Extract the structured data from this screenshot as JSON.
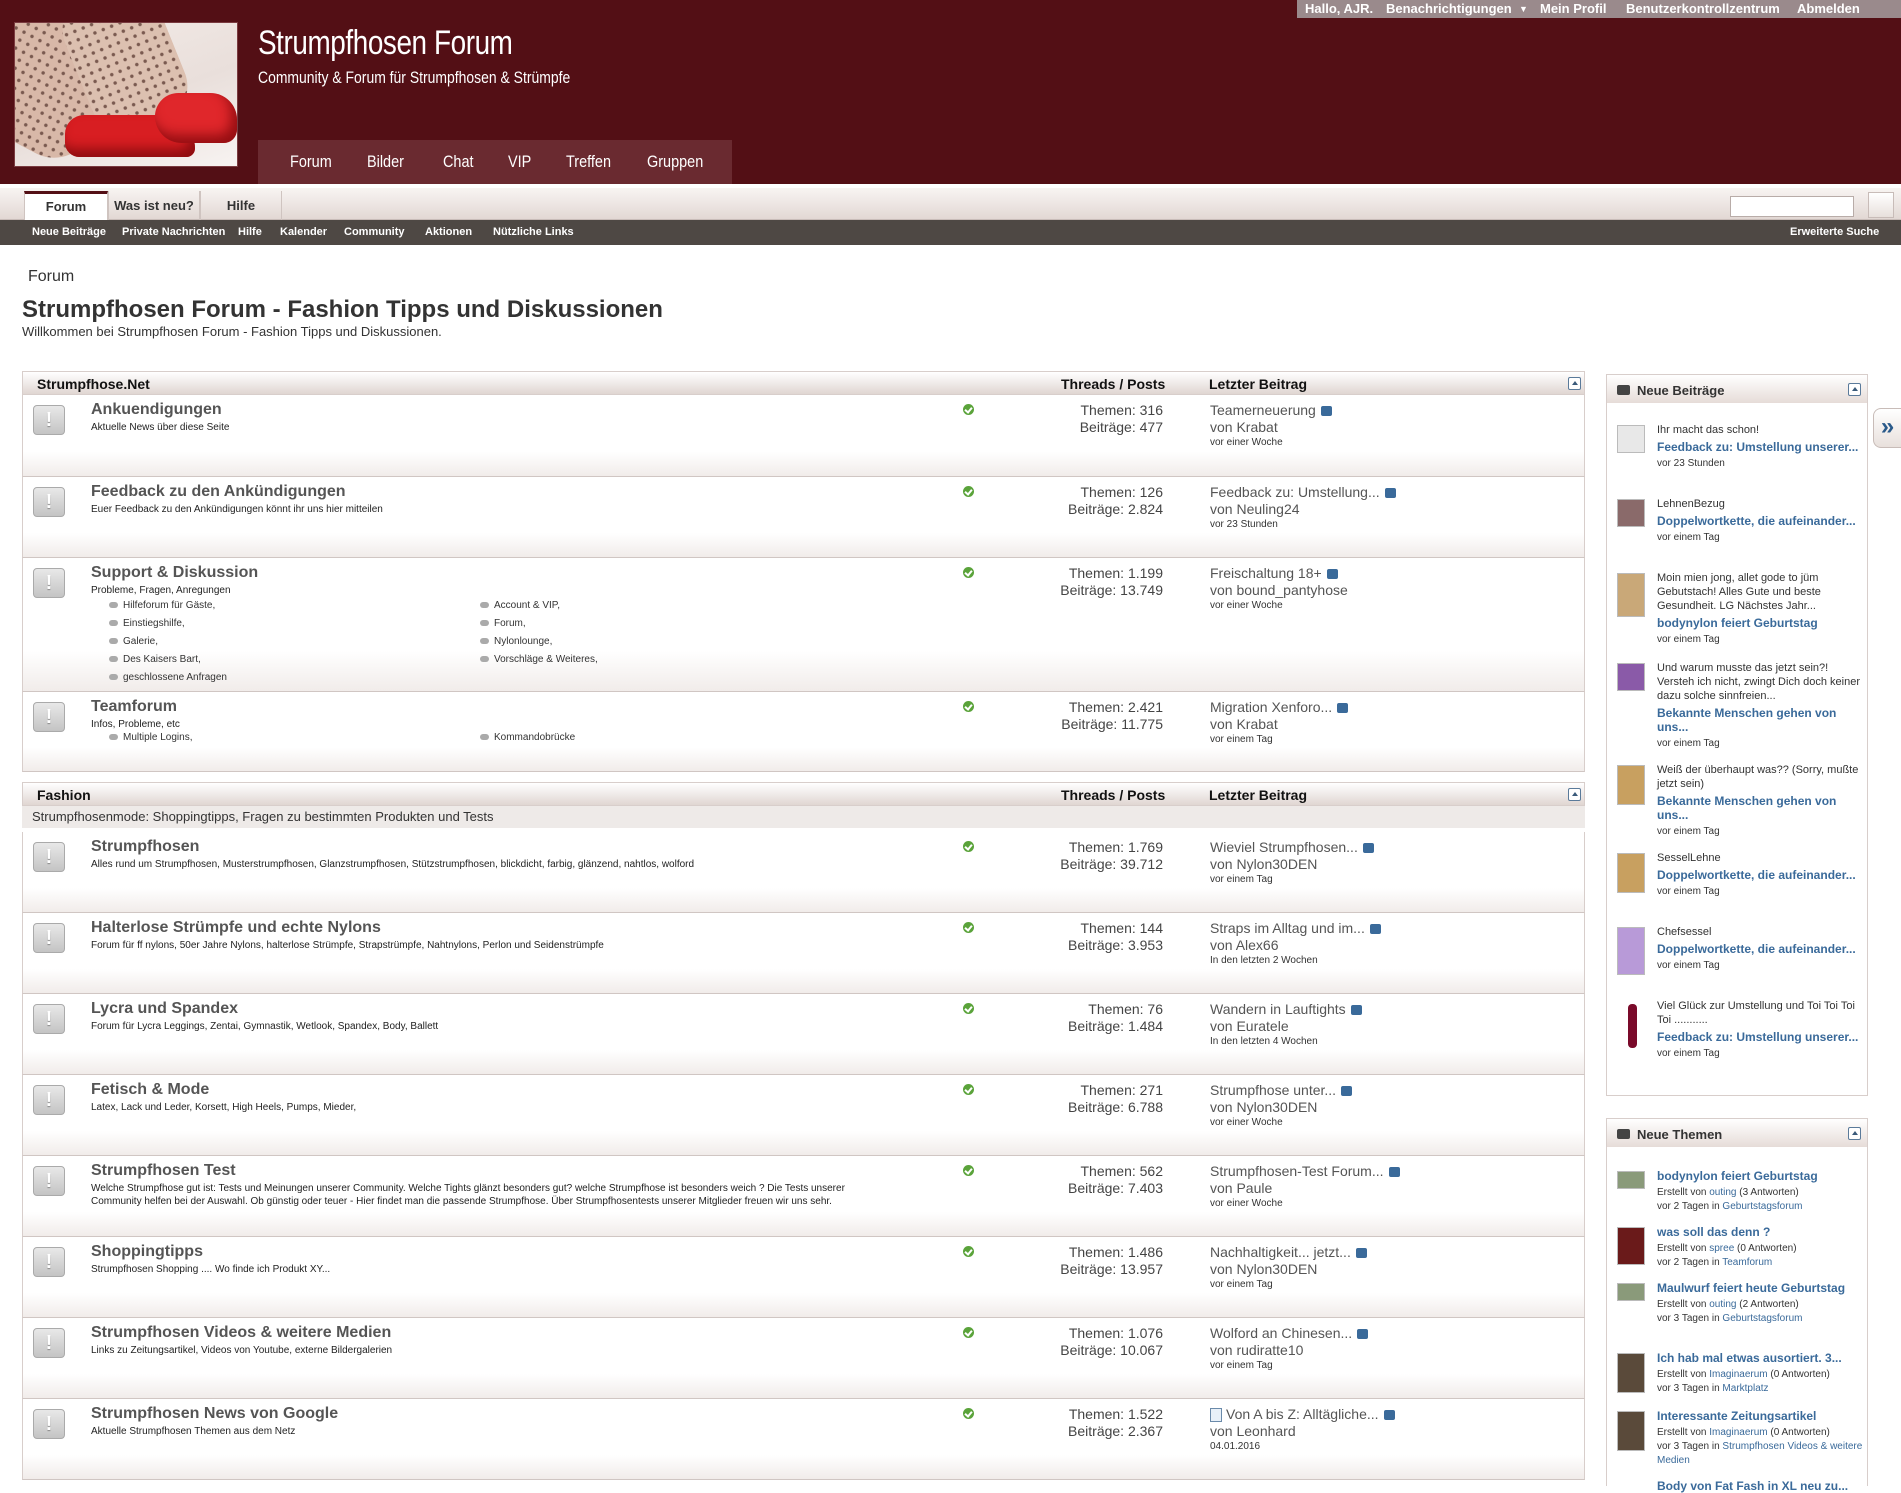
{
  "site": {
    "title": "Strumpfhosen Forum",
    "subtitle": "Community & Forum für Strumpfhosen & Strümpfe"
  },
  "topnav": [
    "Forum",
    "Bilder",
    "Chat",
    "VIP",
    "Treffen",
    "Gruppen"
  ],
  "visitor": {
    "greeting": "Hallo, AJR.",
    "notifications": "Benachrichtigungen",
    "profile": "Mein Profil",
    "cp": "Benutzerkontrollzentrum",
    "logout": "Abmelden"
  },
  "tabs": [
    "Forum",
    "Was ist neu?",
    "Hilfe"
  ],
  "subnav": [
    "Neue Beiträge",
    "Private Nachrichten",
    "Hilfe",
    "Kalender",
    "Community",
    "Aktionen",
    "Nützliche Links"
  ],
  "advanced_search": "Erweiterte Suche",
  "breadcrumb": "Forum",
  "page": {
    "title": "Strumpfhosen Forum - Fashion Tipps und Diskussionen",
    "desc": "Willkommen bei Strumpfhosen Forum - Fashion Tipps und Diskussionen."
  },
  "col": {
    "threads": "Threads / Posts",
    "last": "Letzter Beitrag"
  },
  "cat1": {
    "name": "Strumpfhose.Net",
    "forums": [
      {
        "title": "Ankuendigungen",
        "desc": "Aktuelle News über diese Seite",
        "topics": "Themen: 316",
        "posts": "Beiträge: 477",
        "last": "Teamerneuerung",
        "by": "von Krabat",
        "date": "vor einer Woche"
      },
      {
        "title": "Feedback zu den Ankündigungen",
        "desc": "Euer Feedback zu den Ankündigungen könnt ihr uns hier mitteilen",
        "topics": "Themen: 126",
        "posts": "Beiträge: 2.824",
        "last": "Feedback zu: Umstellung...",
        "by": "von Neuling24",
        "date": "vor 23 Stunden"
      },
      {
        "title": "Support & Diskussion",
        "desc": "Probleme, Fragen, Anregungen",
        "topics": "Themen: 1.199",
        "posts": "Beiträge: 13.749",
        "last": "Freischaltung 18+",
        "by": "von bound_pantyhose",
        "date": "vor einer Woche",
        "subs": [
          "Hilfeforum für Gäste,",
          "Account & VIP,",
          "Einstiegshilfe,",
          "Forum,",
          "Galerie,",
          "Nylonlounge,",
          "Des Kaisers Bart,",
          "Vorschläge & Weiteres,",
          "geschlossene Anfragen"
        ]
      },
      {
        "title": "Teamforum",
        "desc": "Infos, Probleme, etc",
        "topics": "Themen: 2.421",
        "posts": "Beiträge: 11.775",
        "last": "Migration Xenforo...",
        "by": "von Krabat",
        "date": "vor einem Tag",
        "subs": [
          "Multiple Logins,",
          "Kommandobrücke"
        ]
      }
    ]
  },
  "cat2": {
    "name": "Fashion",
    "desc": "Strumpfhosenmode: Shoppingtipps, Fragen zu bestimmten Produkten und Tests",
    "forums": [
      {
        "title": "Strumpfhosen",
        "desc": "Alles rund um Strumpfhosen, Musterstrumpfhosen, Glanzstrumpfhosen, Stützstrumpfhosen, blickdicht, farbig, glänzend, nahtlos, wolford",
        "topics": "Themen: 1.769",
        "posts": "Beiträge: 39.712",
        "last": "Wieviel Strumpfhosen...",
        "by": "von Nylon30DEN",
        "date": "vor einem Tag"
      },
      {
        "title": "Halterlose Strümpfe und echte Nylons",
        "desc": "Forum für ff nylons, 50er Jahre Nylons, halterlose Strümpfe, Strapstrümpfe, Nahtnylons, Perlon und Seidenstrümpfe",
        "topics": "Themen: 144",
        "posts": "Beiträge: 3.953",
        "last": "Straps im Alltag und im...",
        "by": "von Alex66",
        "date": "In den letzten 2 Wochen"
      },
      {
        "title": "Lycra und Spandex",
        "desc": "Forum für Lycra Leggings, Zentai, Gymnastik, Wetlook, Spandex, Body, Ballett",
        "topics": "Themen: 76",
        "posts": "Beiträge: 1.484",
        "last": "Wandern in Lauftights",
        "by": "von Euratele",
        "date": "In den letzten 4 Wochen"
      },
      {
        "title": "Fetisch & Mode",
        "desc": "Latex, Lack und Leder, Korsett, High Heels, Pumps, Mieder,",
        "topics": "Themen: 271",
        "posts": "Beiträge: 6.788",
        "last": "Strumpfhose unter...",
        "by": "von Nylon30DEN",
        "date": "vor einer Woche"
      },
      {
        "title": "Strumpfhosen Test",
        "desc": "Welche Strumpfhose gut ist: Tests und Meinungen unserer Community. Welche Tights glänzt besonders gut? welche Strumpfhose ist besonders weich ? Die Tests unserer Community helfen bei der Auswahl. Ob günstig oder teuer - Hier findet man die passende Strumpfhose. Über Strumpfhosentests unserer Mitglieder freuen wir uns sehr.",
        "topics": "Themen: 562",
        "posts": "Beiträge: 7.403",
        "last": "Strumpfhosen-Test Forum...",
        "by": "von Paule",
        "date": "vor einer Woche"
      },
      {
        "title": "Shoppingtipps",
        "desc": "Strumpfhosen Shopping .... Wo finde ich Produkt XY...",
        "topics": "Themen: 1.486",
        "posts": "Beiträge: 13.957",
        "last": "Nachhaltigkeit... jetzt...",
        "by": "von Nylon30DEN",
        "date": "vor einem Tag"
      },
      {
        "title": "Strumpfhosen Videos & weitere Medien",
        "desc": "Links zu Zeitungsartikel, Videos von Youtube, externe Bildergalerien",
        "topics": "Themen: 1.076",
        "posts": "Beiträge: 10.067",
        "last": "Wolford an Chinesen...",
        "by": "von rudiratte10",
        "date": "vor einem Tag"
      },
      {
        "title": "Strumpfhosen News von Google",
        "desc": "Aktuelle Strumpfhosen Themen aus dem Netz",
        "topics": "Themen: 1.522",
        "posts": "Beiträge: 2.367",
        "last": "Von A bis Z: Alltägliche...",
        "by": "von Leonhard",
        "date": "04.01.2016"
      }
    ]
  },
  "sidebar": {
    "newposts_title": "Neue Beiträge",
    "newposts": [
      {
        "text": "Ihr macht das schon!",
        "link": "Feedback zu: Umstellung unserer...",
        "date": "vor 23 Stunden"
      },
      {
        "text": "LehnenBezug",
        "link": "Doppelwortkette, die aufeinander...",
        "date": "vor einem Tag"
      },
      {
        "text": "Moin mien jong, allet gode to jüm Gebutstach! Alles Gute und beste Gesundheit. LG Nächstes Jahr...",
        "link": "bodynylon feiert Geburtstag",
        "date": "vor einem Tag"
      },
      {
        "text": "Und warum musste das jetzt sein?! Versteh ich nicht, zwingt Dich doch keiner dazu solche sinnfreien...",
        "link": "Bekannte Menschen gehen von uns...",
        "date": "vor einem Tag"
      },
      {
        "text": "Weiß der überhaupt was?? (Sorry, mußte jetzt sein)",
        "link": "Bekannte Menschen gehen von uns...",
        "date": "vor einem Tag"
      },
      {
        "text": "SesselLehne",
        "link": "Doppelwortkette, die aufeinander...",
        "date": "vor einem Tag"
      },
      {
        "text": "Chefsessel",
        "link": "Doppelwortkette, die aufeinander...",
        "date": "vor einem Tag"
      },
      {
        "text": "Viel Glück zur Umstellung und Toi Toi Toi Toi ...........",
        "link": "Feedback zu: Umstellung unserer...",
        "date": "vor einem Tag"
      }
    ],
    "newthreads_title": "Neue Themen",
    "newthreads": [
      {
        "link": "bodynylon feiert Geburtstag",
        "pre": "Erstellt von",
        "user": "outing",
        "rep": "(3 Antworten)",
        "when": "vor 2 Tagen in",
        "forum": "Geburtstagsforum"
      },
      {
        "link": "was soll das denn ?",
        "pre": "Erstellt von",
        "user": "spree",
        "rep": "(0 Antworten)",
        "when": "vor 2 Tagen in",
        "forum": "Teamforum"
      },
      {
        "link": "Maulwurf feiert heute Geburtstag",
        "pre": "Erstellt von",
        "user": "outing",
        "rep": "(2 Antworten)",
        "when": "vor 3 Tagen in",
        "forum": "Geburtstagsforum"
      },
      {
        "link": "Ich hab mal etwas ausortiert. 3...",
        "pre": "Erstellt von",
        "user": "Imaginaerum",
        "rep": "(0 Antworten)",
        "when": "vor 3 Tagen in",
        "forum": "Marktplatz"
      },
      {
        "link": "Interessante Zeitungsartikel",
        "pre": "Erstellt von",
        "user": "Imaginaerum",
        "rep": "(0 Antworten)",
        "when": "vor 3 Tagen in",
        "forum": "Strumpfhosen Videos & weitere Medien"
      },
      {
        "link": "Body von Fat Fash in XL neu zu..."
      }
    ]
  },
  "colors": {
    "header": "#530f15",
    "link": "#3a6a9a",
    "online": "#5aa33a"
  }
}
